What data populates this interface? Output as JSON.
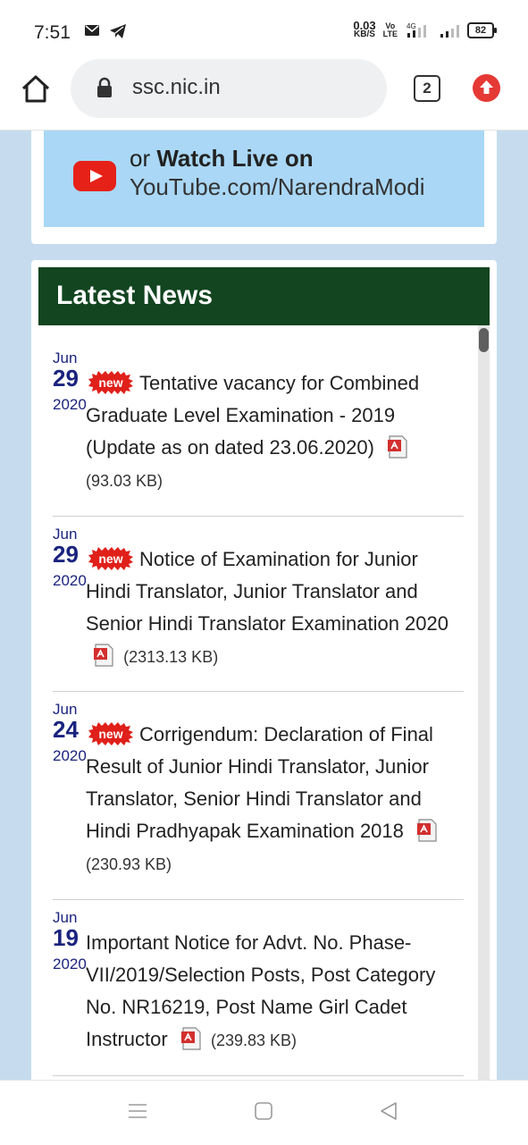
{
  "status_bar": {
    "time": "7:51",
    "net_speed_value": "0.03",
    "net_speed_unit": "KB/S",
    "volte_top": "Vo",
    "volte_bottom": "LTE",
    "network": "4G",
    "battery": "82"
  },
  "browser": {
    "url": "ssc.nic.in",
    "tab_count": "2"
  },
  "banner": {
    "line1_prefix": "or",
    "line1_bold": "Watch Live on",
    "line2": "YouTube.com/NarendraModi"
  },
  "latest_news": {
    "title": "Latest News",
    "badge_text": "new",
    "items": [
      {
        "month": "Jun",
        "day": "29",
        "year": "2020",
        "text": "Tentative vacancy for Combined Graduate Level Examination - 2019 (Update as on dated 23.06.2020)",
        "size": "(93.03 KB)"
      },
      {
        "month": "Jun",
        "day": "29",
        "year": "2020",
        "text": "Notice of Examination for Junior Hindi Translator, Junior Translator and Senior Hindi Translator Examination 2020",
        "size": "(2313.13 KB)"
      },
      {
        "month": "Jun",
        "day": "24",
        "year": "2020",
        "text": "Corrigendum: Declaration of Final Result of Junior Hindi Translator, Junior Translator, Senior Hindi Translator and Hindi Pradhyapak Examination 2018",
        "size": "(230.93 KB)"
      },
      {
        "month": "Jun",
        "day": "19",
        "year": "2020",
        "text": "Important Notice for Advt. No. Phase-VII/2019/Selection Posts, Post Category No. NR16219, Post Name Girl Cadet Instructor",
        "size": "(239.83 KB)"
      }
    ]
  },
  "colors": {
    "news_header_bg": "#124520",
    "page_bg": "#c6dcee",
    "date_color": "#1a237e",
    "banner_bg": "#a9d7f5"
  },
  "icons": [
    "mail-icon",
    "telegram-icon",
    "home-icon",
    "lock-icon",
    "tabs-icon",
    "update-icon",
    "youtube-icon",
    "new-badge-icon",
    "pdf-icon",
    "menu-icon",
    "square-icon",
    "back-icon"
  ]
}
